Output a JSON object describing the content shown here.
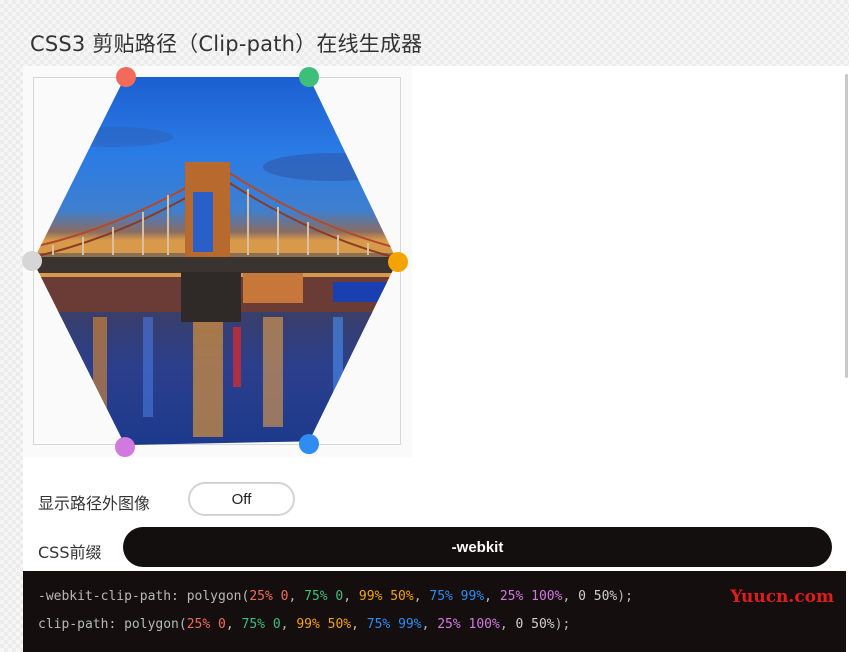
{
  "page": {
    "title": "CSS3 剪贴路径（Clip-path）在线生成器"
  },
  "editor": {
    "points": [
      {
        "name": "handle-1",
        "color": "#f26a5b"
      },
      {
        "name": "handle-2",
        "color": "#3dbf7a"
      },
      {
        "name": "handle-3",
        "color": "#f5a300"
      },
      {
        "name": "handle-4",
        "color": "#2f8cf2"
      },
      {
        "name": "handle-5",
        "color": "#d279e0"
      },
      {
        "name": "handle-6",
        "color": "#d6d6d6"
      }
    ]
  },
  "options": {
    "show_outside_label": "显示路径外图像",
    "show_outside_value": "Off",
    "prefix_label": "CSS前缀",
    "prefix_value": "-webkit"
  },
  "code": {
    "line1_prefix": "-webkit-clip-path: polygon(",
    "line2_prefix": "clip-path: polygon(",
    "coords": [
      "25% 0",
      "75% 0",
      "99% 50%",
      "75% 99%",
      "25% 100%",
      "0 50%"
    ],
    "separator": ", ",
    "suffix": ");",
    "coord_colors": [
      "#f26a5b",
      "#3dbf7a",
      "#f5a300",
      "#2f8cf2",
      "#d279e0",
      "#cfcfcf"
    ]
  },
  "watermark": "Yuucn.com"
}
